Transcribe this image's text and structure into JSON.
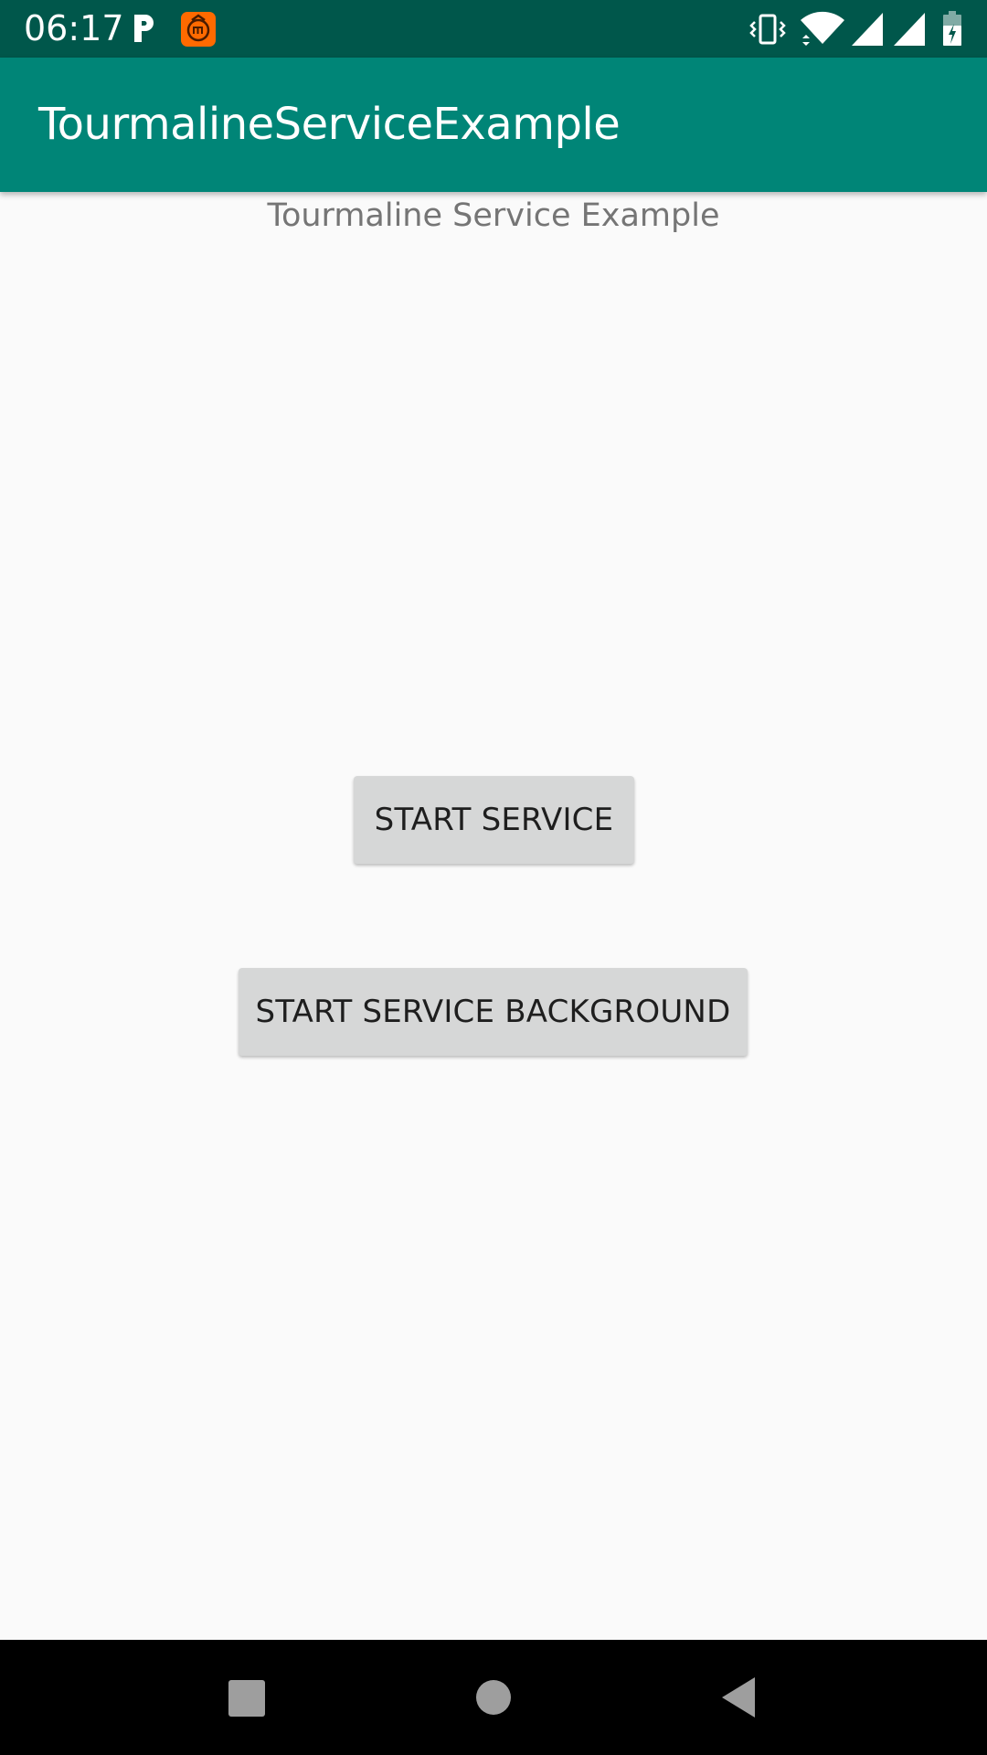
{
  "status_bar": {
    "time": "06:17",
    "icons": [
      "parking-icon",
      "mi-app-icon",
      "vibrate-icon",
      "wifi-icon",
      "signal-icon",
      "signal-icon",
      "battery-charging-icon"
    ],
    "background_color": "#00574b"
  },
  "app_bar": {
    "title": "TourmalineServiceExample",
    "background_color": "#008577"
  },
  "main": {
    "heading": "Tourmaline Service Example",
    "start_service_label": "START SERVICE",
    "start_service_background_label": "START SERVICE BACKGROUND"
  },
  "nav_bar": {
    "icons": [
      "recents-icon",
      "home-icon",
      "back-icon"
    ]
  }
}
